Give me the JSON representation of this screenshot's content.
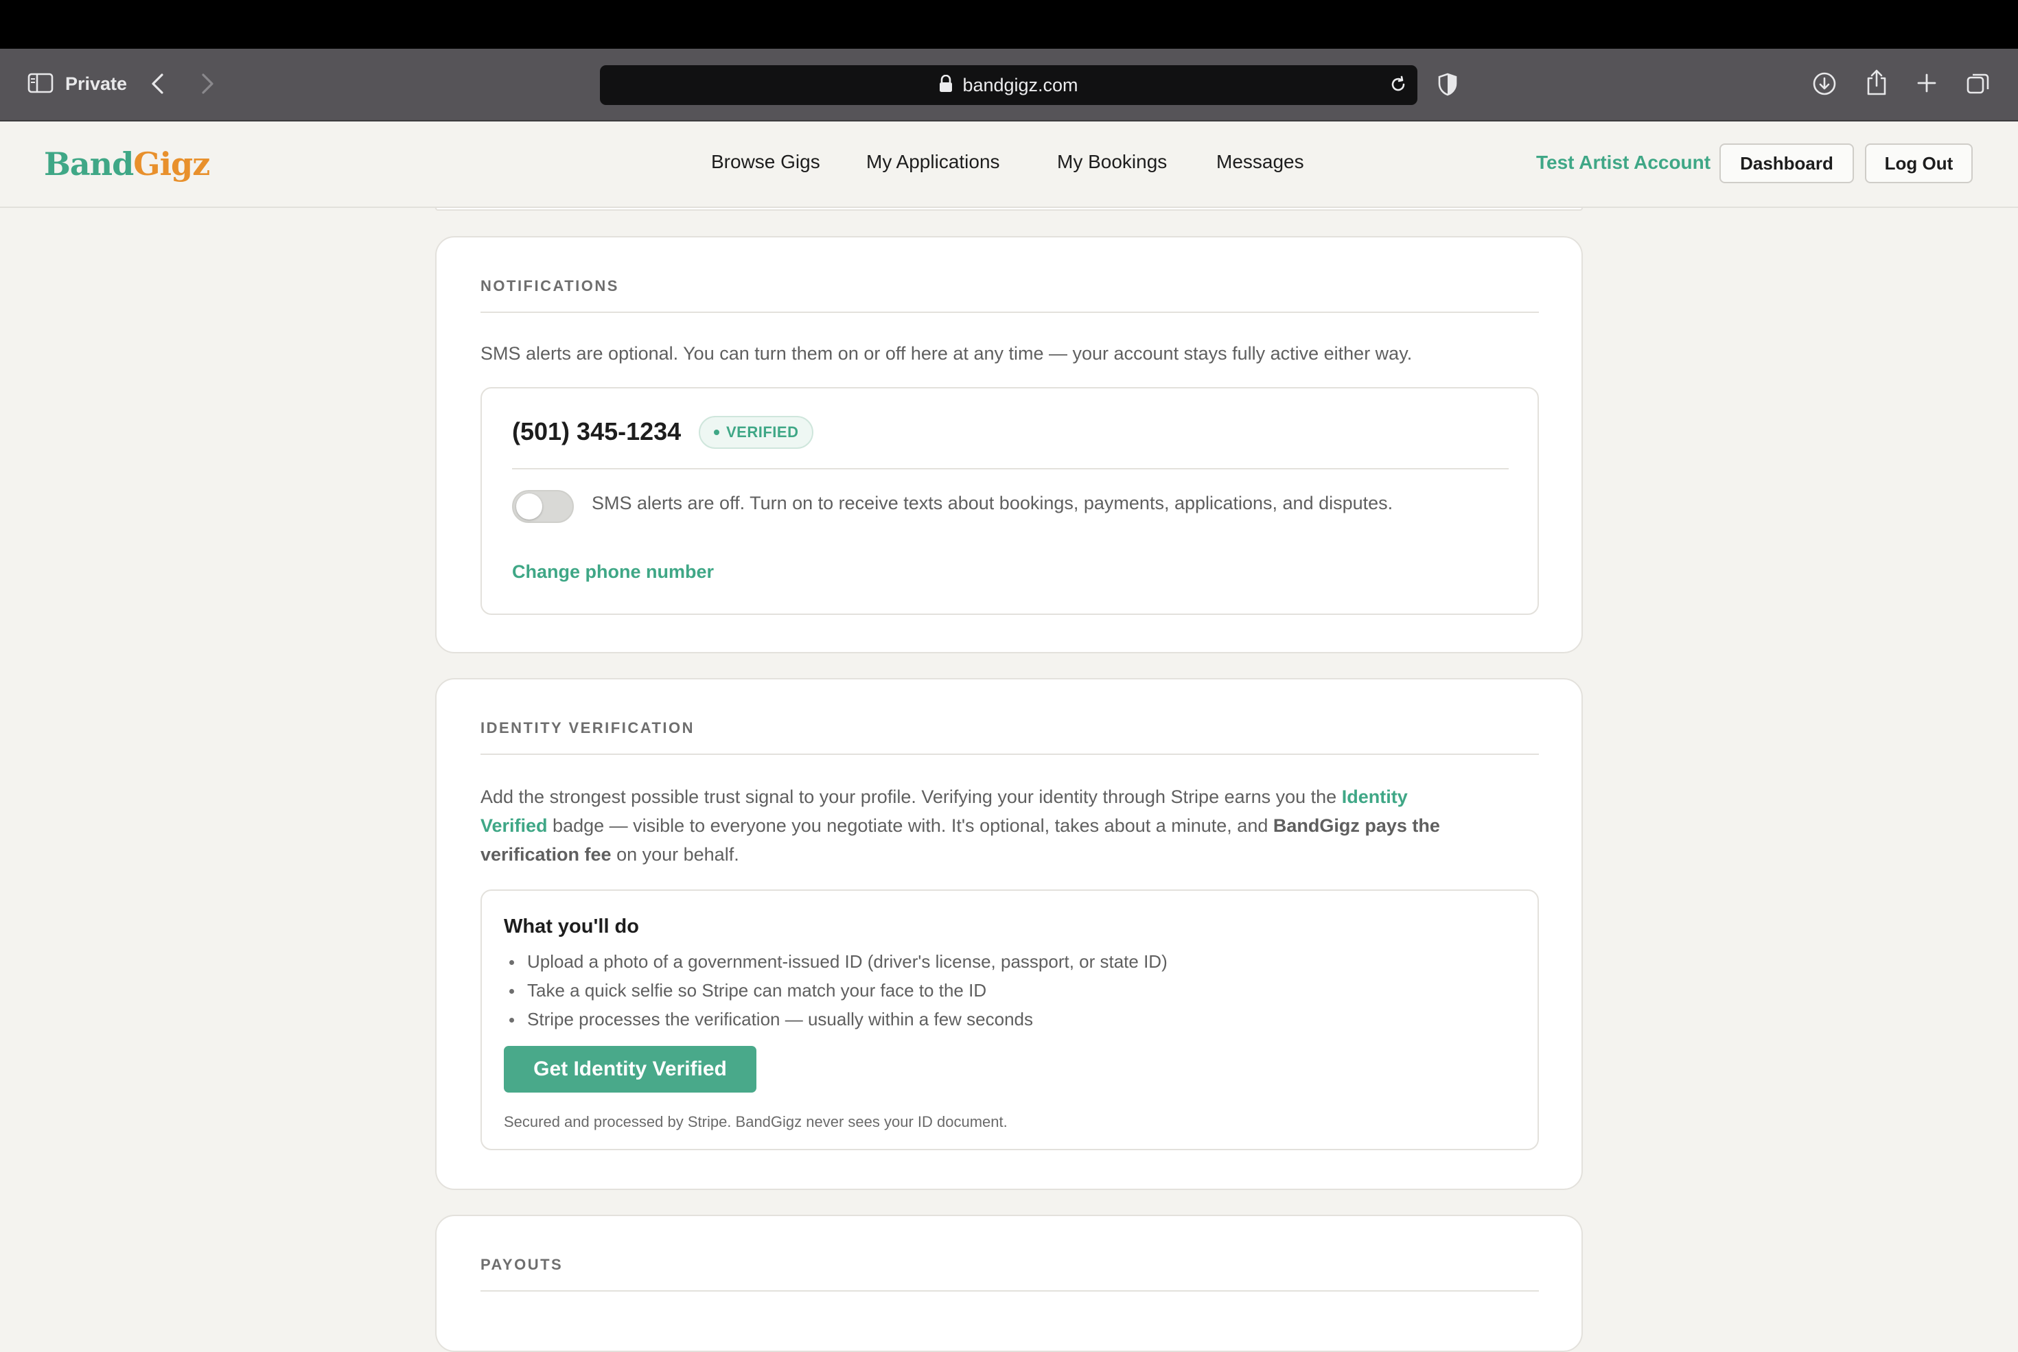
{
  "browser": {
    "private_label": "Private",
    "url": "bandgigz.com"
  },
  "site": {
    "logo_part1": "Band",
    "logo_part2": "Gigz",
    "nav": [
      "Browse Gigs",
      "My Applications",
      "My Bookings",
      "Messages"
    ],
    "account_name": "Test Artist Account",
    "dashboard_label": "Dashboard",
    "logout_label": "Log Out"
  },
  "notifications": {
    "title": "NOTIFICATIONS",
    "description": "SMS alerts are optional. You can turn them on or off here at any time — your account stays fully active either way.",
    "phone": "(501) 345-1234",
    "badge": "VERIFIED",
    "sms_enabled": false,
    "toggle_text": "SMS alerts are off. Turn on to receive texts about bookings, payments, applications, and disputes.",
    "change_phone_label": "Change phone number"
  },
  "identity": {
    "title": "IDENTITY VERIFICATION",
    "desc_1": "Add the strongest possible trust signal to your profile. Verifying your identity through Stripe earns you the ",
    "desc_highlight_1": "Identity",
    "desc_highlight_2": "Verified",
    "desc_2": " badge — visible to everyone you negotiate with. It's optional, takes about a minute, and ",
    "desc_strong_1": "BandGigz pays the",
    "desc_strong_2": "verification fee",
    "desc_3": " on your behalf.",
    "todo_title": "What you'll do",
    "steps": [
      "Upload a photo of a government-issued ID (driver's license, passport, or state ID)",
      "Take a quick selfie so Stripe can match your face to the ID",
      "Stripe processes the verification — usually within a few seconds"
    ],
    "cta_label": "Get Identity Verified",
    "fine_print": "Secured and processed by Stripe. BandGigz never sees your ID document."
  },
  "payouts": {
    "title": "PAYOUTS"
  },
  "colors": {
    "accent_green": "#3fa786",
    "logo_orange": "#e8902c",
    "page_bg": "#f4f3ef"
  }
}
